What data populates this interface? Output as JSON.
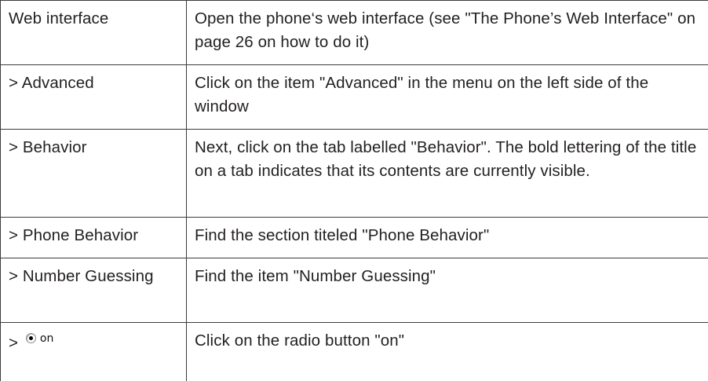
{
  "rows": [
    {
      "step": "Web interface",
      "instruction": "Open the phone‘s web interface (see \"The Phone’s Web Interface\" on page 26 on how to do it)"
    },
    {
      "step": "> Advanced",
      "instruction": "Click on the item \"Advanced\" in the menu on the left side of the window"
    },
    {
      "step": "> Behavior",
      "instruction": "Next, click on the tab labelled \"Behavior\".  The bold lettering of the title on a tab indicates that its contents are currently visible."
    },
    {
      "step": "> Phone Behavior",
      "instruction": "Find the section titeled \"Phone Behavior\""
    },
    {
      "step": "> Number Guessing",
      "instruction": "Find the item \"Number Guessing\""
    },
    {
      "step_prefix": ">",
      "radio_label": "on",
      "radio_icon": "radio-selected-icon",
      "instruction": "Click on the radio button \"on\""
    }
  ]
}
